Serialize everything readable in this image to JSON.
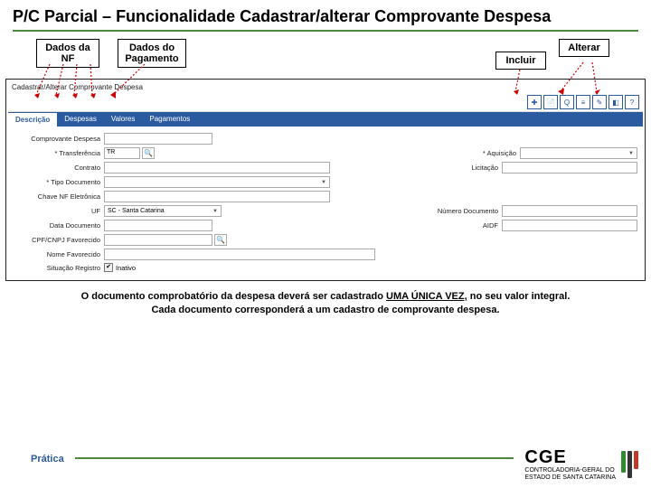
{
  "slide": {
    "title": "P/C Parcial – Funcionalidade Cadastrar/alterar Comprovante Despesa"
  },
  "labels": {
    "nf": "Dados da NF",
    "pagamento": "Dados do Pagamento",
    "incluir": "Incluir",
    "alterar": "Alterar"
  },
  "app": {
    "window_title": "Cadastrar/Alterar Comprovante Despesa",
    "tabs": {
      "descricao": "Descrição",
      "despesas": "Despesas",
      "valores": "Valores",
      "pagamentos": "Pagamentos"
    },
    "fields": {
      "comprovante_despesa": "Comprovante Despesa",
      "transferencia": "* Transferência",
      "transferencia_value": "TR",
      "contrato": "Contrato",
      "tipo_documento": "* Tipo Documento",
      "chave_nf": "Chave NF Eletrônica",
      "uf": "UF",
      "uf_value": "SC - Santa Catarina",
      "data_documento": "Data Documento",
      "cpf_cnpj": "CPF/CNPJ Favorecido",
      "nome_favorecido": "Nome Favorecido",
      "situacao": "Situação Registro",
      "situacao_value": "Inativo",
      "aquisicao": "* Aquisição",
      "licitacao": "Licitação",
      "numero_documento": "Número Documento",
      "aidf": "AIDF"
    },
    "toolbar": {
      "t1": "✚",
      "t2": "📄",
      "t3": "Q",
      "t4": "≡",
      "t5": "✎",
      "t6": "◧",
      "t7": "?"
    }
  },
  "note": {
    "line1_a": "O documento comprobatório da despesa deverá ser cadastrado ",
    "line1_b": "UMA ÚNICA VEZ,",
    "line1_c": " no seu valor integral.",
    "line2": "Cada documento  corresponderá a um cadastro de comprovante despesa."
  },
  "footer": {
    "practice": "Prática",
    "logo_big": "CGE",
    "logo_small1": "CONTROLADORIA-GERAL DO",
    "logo_small2": "ESTADO DE SANTA CATARINA"
  }
}
